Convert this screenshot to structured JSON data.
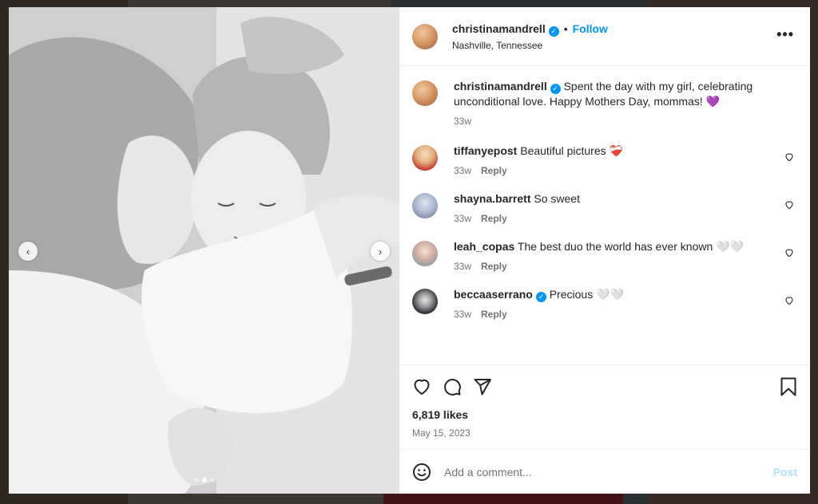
{
  "post": {
    "username": "christinamandrell",
    "follow_label": "Follow",
    "location": "Nashville, Tennessee",
    "more_label": "•••",
    "caption": "Spent the day with my girl, celebrating unconditional love. Happy Mothers Day, mommas! 💜",
    "caption_time": "33w",
    "likes": "6,819 likes",
    "date": "May 15, 2023",
    "carousel": {
      "total_slides": 3,
      "active_slide": 2
    }
  },
  "comments": [
    {
      "username": "tiffanyepost",
      "text": "Beautiful pictures ❤️‍🩹",
      "time": "33w",
      "reply": "Reply",
      "verified": false
    },
    {
      "username": "shayna.barrett",
      "text": "So sweet",
      "time": "33w",
      "reply": "Reply",
      "verified": false
    },
    {
      "username": "leah_copas",
      "text": "The best duo the world has ever known 🤍🤍",
      "time": "33w",
      "reply": "Reply",
      "verified": false
    },
    {
      "username": "beccaaserrano",
      "text": "Precious 🤍🤍",
      "time": "33w",
      "reply": "Reply",
      "verified": true
    }
  ],
  "composer": {
    "placeholder": "Add a comment...",
    "post_label": "Post"
  },
  "colors": {
    "accent": "#0095f6",
    "text": "#262626",
    "muted": "#737373",
    "post_disabled": "#b2dffc"
  },
  "icons": [
    "verified-icon",
    "heart-icon",
    "comment-icon",
    "share-icon",
    "bookmark-icon",
    "emoji-icon",
    "chevron-left-icon",
    "chevron-right-icon",
    "more-icon"
  ]
}
